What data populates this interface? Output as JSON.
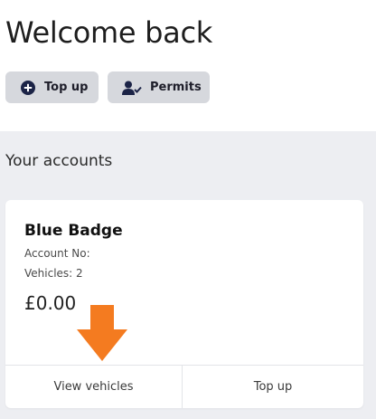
{
  "header": {
    "title": "Welcome back",
    "buttons": [
      {
        "label": "Top up",
        "icon": "plus-circle-icon"
      },
      {
        "label": "Permits",
        "icon": "user-check-icon"
      }
    ]
  },
  "accounts_section": {
    "title": "Your accounts"
  },
  "account_card": {
    "name": "Blue Badge",
    "account_no_label": "Account No:",
    "vehicles_label": "Vehicles: 2",
    "balance": "£0.00",
    "actions": [
      {
        "label": "View vehicles"
      },
      {
        "label": "Top up"
      }
    ],
    "annotation_icon": "arrow-down-icon"
  },
  "colors": {
    "page_bg": "#edeef2",
    "card_bg": "#ffffff",
    "button_bg": "#d6d8dd",
    "icon_navy": "#1b2346",
    "arrow_orange": "#f47b20"
  }
}
